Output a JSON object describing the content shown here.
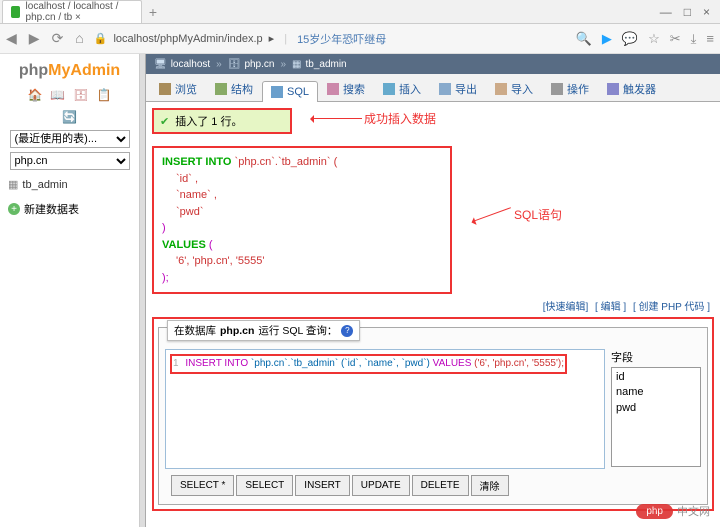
{
  "browser": {
    "tab_title": "localhost / localhost / php.cn / tb ×",
    "win": {
      "min": "—",
      "max": "□",
      "close": "×"
    },
    "nav": {
      "back": "◀",
      "fwd": "▶",
      "reload": "⟳",
      "home": "⌂"
    },
    "url": "localhost/phpMyAdmin/index.p",
    "url_tail": "▸",
    "promo": "15岁少年恐吓继母",
    "icons": {
      "search": "🔍",
      "play": "▶",
      "chat": "💬",
      "star": "☆",
      "cut": "✂",
      "dl": "⤓",
      "menu": "≡"
    }
  },
  "logo": {
    "p1": "php",
    "p2": "MyAdmin"
  },
  "sidebar": {
    "recent_label": "(最近使用的表)...",
    "db_label": "php.cn",
    "tree_item": "tb_admin",
    "new_table": "新建数据表"
  },
  "crumb": {
    "host_icon": "🖥",
    "host": "localhost",
    "db_icon": "🗄",
    "db": "php.cn",
    "tbl_icon": "▦",
    "tbl": "tb_admin",
    "sep": "»"
  },
  "tabs": {
    "browse": "浏览",
    "struct": "结构",
    "sql": "SQL",
    "search": "搜索",
    "insert": "插入",
    "export": "导出",
    "import": "导入",
    "ops": "操作",
    "trig": "触发器"
  },
  "success_msg": "插入了 1 行。",
  "annotation1": "成功插入数据",
  "annotation2": "SQL语句",
  "sql_display": {
    "l1a": "INSERT INTO",
    "l1b": " `php.cn`.`tb_admin` (",
    "l2": "`id` ,",
    "l3": "`name` ,",
    "l4": "`pwd`",
    "l5": ")",
    "l6a": "VALUES",
    "l6b": " (",
    "l7": "'6', 'php.cn', '5555'",
    "l8": ");"
  },
  "links": {
    "a": "[快速编辑]",
    "b": "[ 编辑 ]",
    "c": "[ 创建 PHP 代码 ]"
  },
  "query_head_prefix": "在数据库 ",
  "query_head_db": "php.cn",
  "query_head_suffix": " 运行 SQL 查询：",
  "editor_line": "INSERT INTO `php.cn`.`tb_admin` (`id`, `name`, `pwd`) VALUES ('6', 'php.cn', '5555');",
  "editor_tokens": {
    "t1": "INSERT INTO",
    "t2": "`php.cn`.`tb_admin`",
    "t3": "(`id`, `name`, `pwd`)",
    "t4": "VALUES",
    "t5": "('6', 'php.cn', '5555');"
  },
  "fields": {
    "label": "字段",
    "items": [
      "id",
      "name",
      "pwd"
    ]
  },
  "buttons": {
    "select_all": "SELECT *",
    "select": "SELECT",
    "insert": "INSERT",
    "update": "UPDATE",
    "delete": "DELETE",
    "clear": "清除"
  },
  "watermark": {
    "pill": "php",
    "text": "中文网"
  }
}
